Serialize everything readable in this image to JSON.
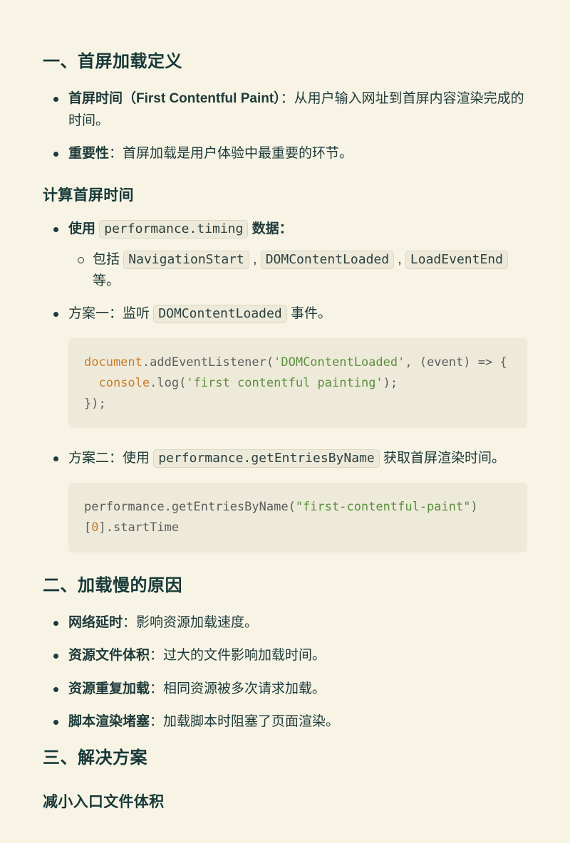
{
  "section1": {
    "heading": "一、首屏加载定义",
    "list": [
      {
        "bold1": "首屏时间（First Contentful Paint）",
        "rest1": "：从用户输入网址到首屏内容渲染完成的时间。"
      },
      {
        "bold2": "重要性",
        "rest2": "：首屏加载是用户体验中最重要的环节。"
      }
    ]
  },
  "section1b": {
    "heading": "计算首屏时间",
    "item1_pre": "使用 ",
    "item1_code": "performance.timing",
    "item1_post": " 数据：",
    "sub_pre": "包括 ",
    "sub_c1": "NavigationStart",
    "sub_s1": " , ",
    "sub_c2": "DOMContentLoaded",
    "sub_s2": " , ",
    "sub_c3": "LoadEventEnd",
    "sub_post": " 等。",
    "item2_pre": "方案一：监听 ",
    "item2_code": "DOMContentLoaded",
    "item2_post": " 事件。",
    "code1": {
      "t1": "document",
      "t2": ".addEventListener(",
      "t3": "'DOMContentLoaded'",
      "t4": ", (event) => {",
      "t5": "  ",
      "t6": "console",
      "t7": ".log(",
      "t8": "'first contentful painting'",
      "t9": ");",
      "t10": "});"
    },
    "item3_pre": "方案二：使用 ",
    "item3_code": "performance.getEntriesByName",
    "item3_post": " 获取首屏渲染时间。",
    "code2": {
      "t1": "performance.getEntriesByName(",
      "t2": "\"first-contentful-paint\"",
      "t3": ")[",
      "t4": "0",
      "t5": "].startTime"
    }
  },
  "section2": {
    "heading": "二、加载慢的原因",
    "items": [
      {
        "b": "网络延时",
        "r": "：影响资源加载速度。"
      },
      {
        "b": "资源文件体积",
        "r": "：过大的文件影响加载时间。"
      },
      {
        "b": "资源重复加载",
        "r": "：相同资源被多次请求加载。"
      },
      {
        "b": "脚本渲染堵塞",
        "r": "：加载脚本时阻塞了页面渲染。"
      }
    ]
  },
  "section3": {
    "heading": "三、解决方案",
    "sub": "减小入口文件体积"
  }
}
